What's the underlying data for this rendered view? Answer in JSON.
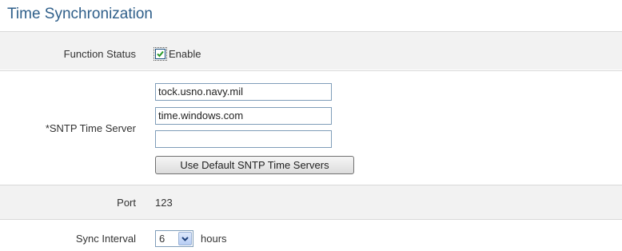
{
  "section": {
    "title": "Time Synchronization"
  },
  "function_status": {
    "label": "Function Status",
    "checkbox_label": "Enable",
    "checked": true
  },
  "sntp": {
    "label": "*SNTP Time Server",
    "servers": [
      "tock.usno.navy.mil",
      "time.windows.com",
      ""
    ],
    "default_button": "Use Default SNTP Time Servers"
  },
  "port": {
    "label": "Port",
    "value": "123"
  },
  "sync_interval": {
    "label": "Sync Interval",
    "selected": "6",
    "unit": "hours"
  },
  "icons": {
    "check": "checkmark-icon",
    "dropdown": "chevron-down-icon"
  },
  "colors": {
    "title": "#2f5f8a",
    "row_shade": "#f2f2f2",
    "accent": "#1c5180"
  }
}
